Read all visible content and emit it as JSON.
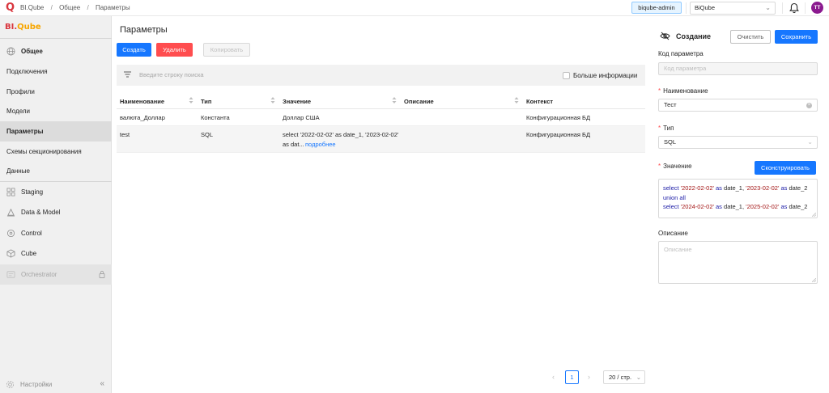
{
  "topbar": {
    "breadcrumb": [
      "BI.Qube",
      "Общее",
      "Параметры"
    ],
    "separator": "/",
    "admin_badge": "biqube-admin",
    "project_select": "BiQube",
    "avatar_initials": "TT"
  },
  "sidebar": {
    "logo_text_a": "BI.",
    "logo_text_b": "Qube",
    "group_general": "Общее",
    "items": [
      {
        "label": "Подключения"
      },
      {
        "label": "Профили"
      },
      {
        "label": "Модели"
      },
      {
        "label": "Параметры"
      },
      {
        "label": "Схемы секционирования"
      },
      {
        "label": "Данные"
      }
    ],
    "modules": [
      {
        "label": "Staging",
        "icon": "staging-icon"
      },
      {
        "label": "Data & Model",
        "icon": "data-model-icon"
      },
      {
        "label": "Control",
        "icon": "control-icon"
      },
      {
        "label": "Cube",
        "icon": "cube-icon"
      },
      {
        "label": "Orchestrator",
        "icon": "orchestrator-icon"
      }
    ],
    "settings_label": "Настройки",
    "collapse_glyph": "«"
  },
  "main": {
    "title": "Параметры",
    "create_button": "Создать",
    "delete_button": "Удалить",
    "copy_button": "Копировать",
    "search_placeholder": "Введите строку поиска",
    "more_info_label": "Больше информации",
    "columns": [
      "Наименование",
      "Тип",
      "Значение",
      "Описание",
      "Контекст"
    ],
    "rows": [
      {
        "name": "валюта_Доллар",
        "type": "Константа",
        "value": "Доллар США",
        "description": "",
        "context": "Конфигурационная БД"
      },
      {
        "name": "test",
        "type": "SQL",
        "value_line1": "select '2022-02-02' as date_1, '2023-02-02'",
        "value_line2": "as dat...",
        "value_more": "подробнее",
        "description": "",
        "context": "Конфигурационная БД"
      }
    ],
    "pagination": {
      "current_page": "1",
      "page_size": "20 / стр."
    }
  },
  "panel": {
    "title": "Создание",
    "clear_button": "Очистить",
    "save_button": "Сохранить",
    "code_label": "Код параметра",
    "code_placeholder": "Код параметра",
    "name_label": "Наименование",
    "name_value": "Тест",
    "type_label": "Тип",
    "type_value": "SQL",
    "value_label": "Значение",
    "construct_button": "Сконструировать",
    "sql": {
      "select": "select",
      "d1": "'2022-02-02'",
      "as": "as",
      "a1": "date_1,",
      "d2": "'2023-02-02'",
      "a2": "date_2",
      "union": "union all",
      "d3": "'2024-02-02'",
      "d4": "'2025-02-02'"
    },
    "description_label": "Описание",
    "description_placeholder": "Описание"
  }
}
